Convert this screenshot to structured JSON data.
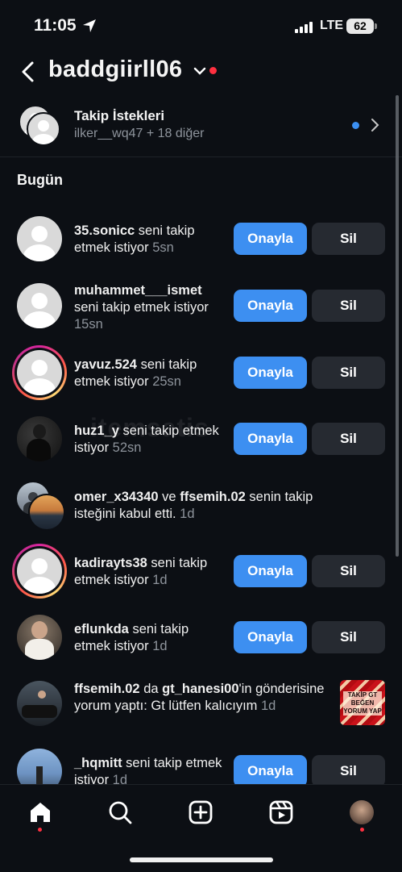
{
  "status": {
    "time": "11:05",
    "network": "LTE",
    "battery": "62"
  },
  "header": {
    "username": "baddgiirll06"
  },
  "requests": {
    "title": "Takip İstekleri",
    "subtitle": "ilker__wq47 + 18 diğer"
  },
  "section_title": "Bugün",
  "buttons": {
    "confirm": "Onayla",
    "delete": "Sil"
  },
  "notifications": [
    {
      "user": "35.sonicc",
      "text": " seni takip etmek istiyor ",
      "time": "5sn"
    },
    {
      "user": "muhammet___ismet",
      "text": " seni takip etmek istiyor ",
      "time": "15sn"
    },
    {
      "user": "yavuz.524",
      "text": " seni takip etmek istiyor ",
      "time": "25sn"
    },
    {
      "user": "huz1_y",
      "text": " seni takip etmek istiyor ",
      "time": "52sn"
    },
    {
      "user": "omer_x34340",
      "connector": " ve ",
      "user2": "ffsemih.02",
      "text": " senin takip isteğini kabul etti. ",
      "time": "1d"
    },
    {
      "user": "kadirayts38",
      "text": " seni takip etmek istiyor ",
      "time": "1d"
    },
    {
      "user": "eflunkda",
      "text": " seni takip etmek istiyor ",
      "time": "1d"
    },
    {
      "user": "ffsemih.02",
      "connector": " da ",
      "user2": "gt_hanesi00",
      "text": "'in gönderisine yorum yaptı: Gt lütfen kalıcıyım ",
      "time": "1d",
      "thumb_text": "TAKİP GT BEĞEN YORUM YAP"
    },
    {
      "user": "_hqmitt",
      "text": " seni takip etmek istiyor ",
      "time": "1d"
    }
  ],
  "watermark": "itemsatis",
  "icons": [
    "location-arrow-icon",
    "signal-icon",
    "back-chevron-icon",
    "chevron-down-icon",
    "chevron-right-icon",
    "home-icon",
    "search-icon",
    "create-icon",
    "reels-icon",
    "profile-avatar-icon"
  ],
  "colors": {
    "background": "#0c0f14",
    "accent": "#3d8ff1",
    "notification": "#ff3040",
    "secondary_button": "#262a31"
  }
}
